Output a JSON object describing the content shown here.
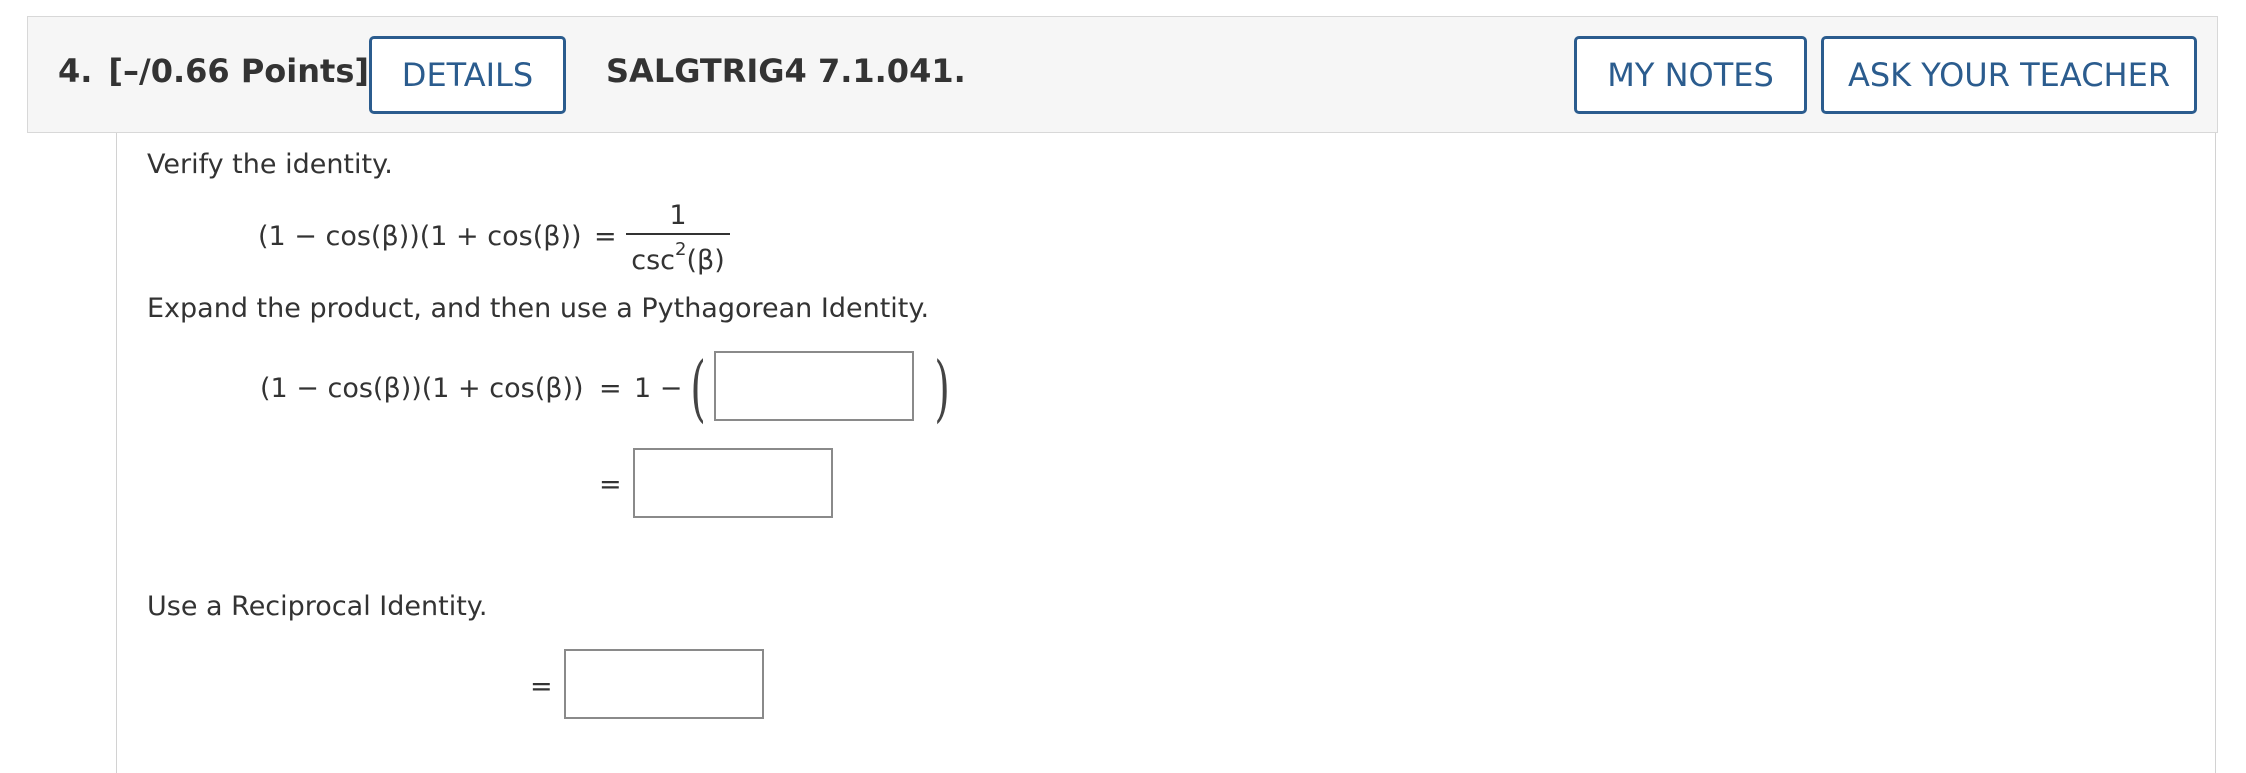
{
  "header": {
    "question_number": "4.",
    "points": "[–/0.66 Points]",
    "details_label": "DETAILS",
    "question_code": "SALGTRIG4 7.1.041.",
    "my_notes_label": "MY NOTES",
    "ask_teacher_label": "ASK YOUR TEACHER"
  },
  "content": {
    "instruction1": "Verify the identity.",
    "identity_lhs": "(1 − cos(β))(1 + cos(β))",
    "equals": "=",
    "identity_rhs_numerator": "1",
    "identity_rhs_denominator_base": "csc",
    "identity_rhs_denominator_exp": "2",
    "identity_rhs_denominator_arg": "(β)",
    "instruction2": "Expand the product, and then use a Pythagorean Identity.",
    "step1_lhs": "(1 − cos(β))(1 + cos(β))",
    "step1_rhs_prefix": "1 −",
    "open_paren": "(",
    "close_paren": ")",
    "instruction3": "Use a Reciprocal Identity.",
    "answers": {
      "a1": "",
      "a2": "",
      "a3": ""
    }
  }
}
